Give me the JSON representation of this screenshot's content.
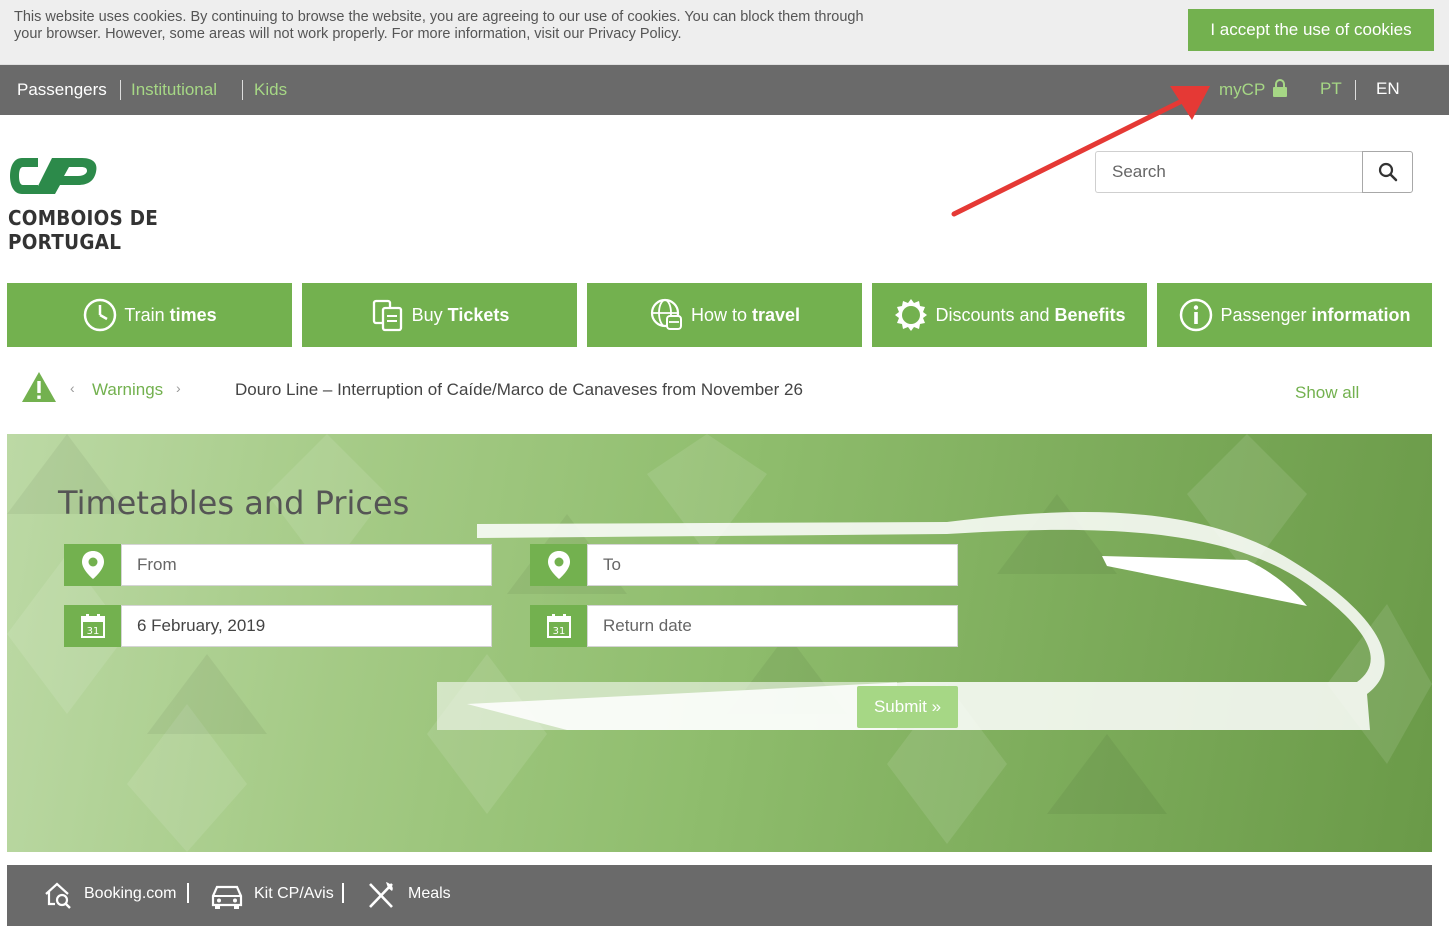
{
  "cookie": {
    "text": "This website uses cookies. By continuing to browse the website, you are agreeing to our use of cookies. You can block them through your browser. However, some areas will not work properly. For more information, visit our Privacy Policy.",
    "accept_label": "I accept the use of cookies"
  },
  "top_nav": {
    "left_items": [
      "Passengers",
      "Institutional",
      "Kids"
    ],
    "mycp_label": "myCP",
    "lang_pt": "PT",
    "lang_en": "EN"
  },
  "header": {
    "logo_text": "COMBOIOS DE PORTUGAL",
    "search_placeholder": "Search"
  },
  "main_nav": [
    {
      "light": "Train",
      "bold": "times",
      "icon": "clock-icon"
    },
    {
      "light": "Buy",
      "bold": "Tickets",
      "icon": "tickets-icon"
    },
    {
      "light": "How to",
      "bold": "travel",
      "icon": "globe-train-icon"
    },
    {
      "light": "Discounts and",
      "bold": "Benefits",
      "icon": "badge-icon"
    },
    {
      "light": "Passenger",
      "bold": "information",
      "icon": "info-icon"
    }
  ],
  "warnings": {
    "label": "Warnings",
    "prev": "‹",
    "next": "›",
    "text": "Douro Line – Interruption of Caíde/Marco de Canaveses from November 26",
    "show_all": "Show all"
  },
  "search_form": {
    "title": "Timetables and Prices",
    "from_placeholder": "From",
    "to_placeholder": "To",
    "date_value": "6 February, 2019",
    "return_placeholder": "Return date",
    "calendar_day": "31",
    "submit_label": "Submit »"
  },
  "footer_links": [
    "Booking.com",
    "Kit CP/Avis",
    "Meals"
  ],
  "colors": {
    "brand_green": "#73b14f",
    "light_green": "#a6d785",
    "bar_gray": "#6a6a6a",
    "arrow_red": "#e53935"
  }
}
